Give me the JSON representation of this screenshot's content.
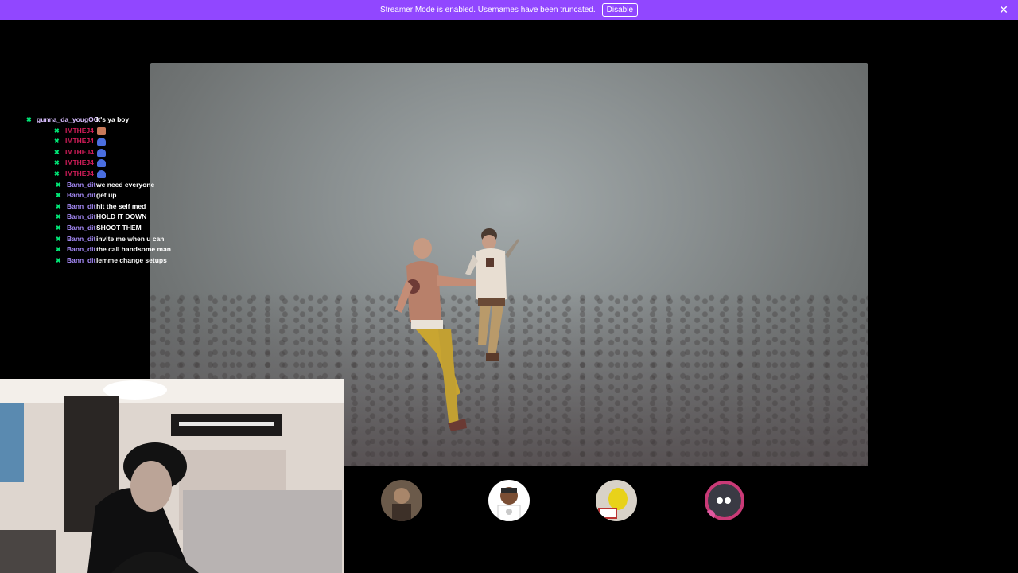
{
  "banner": {
    "message": "Streamer Mode is enabled. Usernames have been truncated.",
    "disable_label": "Disable",
    "close_glyph": "✕"
  },
  "chat": {
    "badge_glyph": "✖",
    "messages": [
      {
        "user": "gunna_da_yougOG",
        "text": "It's ya boy",
        "user_color": "#d9bfff"
      },
      {
        "user": "IMTHEJ4",
        "text": "",
        "emote": "face-emote",
        "user_color": "#d31d5a"
      },
      {
        "user": "IMTHEJ4",
        "text": "",
        "emote": "blue-bird-emote",
        "user_color": "#d31d5a"
      },
      {
        "user": "IMTHEJ4",
        "text": "",
        "emote": "blue-bird-emote",
        "user_color": "#d31d5a"
      },
      {
        "user": "IMTHEJ4",
        "text": "",
        "emote": "blue-bird-emote",
        "user_color": "#d31d5a"
      },
      {
        "user": "IMTHEJ4",
        "text": "",
        "emote": "blue-bird-emote",
        "user_color": "#d31d5a"
      },
      {
        "user": "Bann_dit",
        "text": "we need everyone",
        "user_color": "#a78bfa"
      },
      {
        "user": "Bann_dit",
        "text": "get up",
        "user_color": "#a78bfa"
      },
      {
        "user": "Bann_dit",
        "text": "hit the self med",
        "user_color": "#a78bfa"
      },
      {
        "user": "Bann_dit",
        "text": "HOLD IT DOWN",
        "user_color": "#a78bfa"
      },
      {
        "user": "Bann_dit",
        "text": "SHOOT THEM",
        "user_color": "#a78bfa"
      },
      {
        "user": "Bann_dit",
        "text": "invite me when u can",
        "user_color": "#a78bfa"
      },
      {
        "user": "Bann_dit",
        "text": "the call handsome man",
        "user_color": "#a78bfa"
      },
      {
        "user": "Bann_dit",
        "text": "lemme change setups",
        "user_color": "#a78bfa"
      }
    ]
  },
  "squad": {
    "tiles": [
      {
        "name": "squad-tile-1",
        "bg": "#3a3628",
        "avatar_icon": "bearded-man-avatar"
      },
      {
        "name": "squad-tile-2",
        "bg": "#9a5a32",
        "avatar_icon": "man-with-chain-avatar"
      },
      {
        "name": "squad-tile-3",
        "bg": "#3a3628",
        "avatar_icon": "yellow-character-avatar"
      },
      {
        "name": "squad-tile-4",
        "bg": "#7fd3df",
        "avatar_icon": "anime-character-avatar"
      }
    ]
  },
  "colors": {
    "brand": "#9147ff",
    "badge_green": "#00e676"
  }
}
